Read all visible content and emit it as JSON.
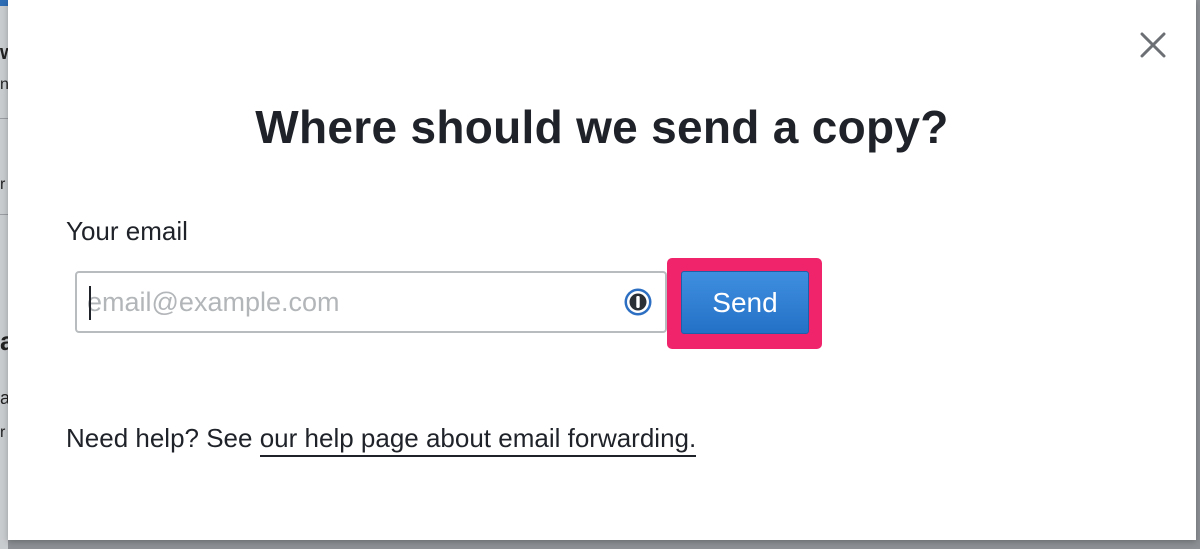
{
  "modal": {
    "title": "Where should we send a copy?",
    "close_icon": "close-icon"
  },
  "form": {
    "email_label": "Your email",
    "email_value": "",
    "email_placeholder": "email@example.com",
    "password_manager_icon": "password-manager-icon",
    "send_label": "Send"
  },
  "help": {
    "prefix": "Need help? See ",
    "link_text": "our help page about email forwarding."
  },
  "colors": {
    "highlight": "#f0246b",
    "send_button": "#2a78cd",
    "text": "#1f2329"
  },
  "background_fragments": [
    "w",
    "n",
    "r",
    "a",
    "a",
    "r"
  ]
}
